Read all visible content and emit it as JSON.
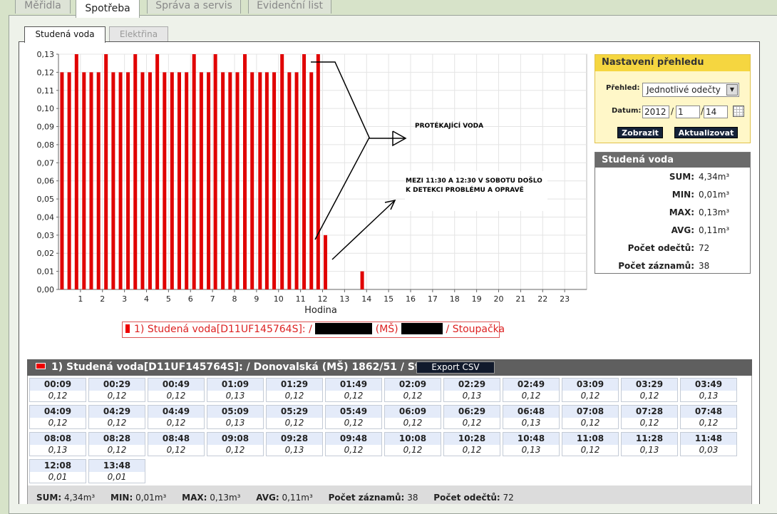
{
  "tabs": [
    "Měřidla",
    "Spotřeba",
    "Správa a servis",
    "Evidenční list"
  ],
  "active_tab": "Spotřeba",
  "sub_tabs": [
    "Studená voda",
    "Elektřina"
  ],
  "active_sub_tab": "Studená voda",
  "chart_data": {
    "type": "bar",
    "xlabel": "Hodina",
    "ylabel": "",
    "ylim": [
      0,
      0.13
    ],
    "xlim": [
      0,
      24
    ],
    "x_ticks": [
      "1",
      "2",
      "3",
      "4",
      "5",
      "6",
      "7",
      "8",
      "9",
      "10",
      "11",
      "12",
      "13",
      "14",
      "15",
      "16",
      "17",
      "18",
      "19",
      "20",
      "21",
      "22",
      "23"
    ],
    "y_ticks": [
      "0,00",
      "0,01",
      "0,02",
      "0,03",
      "0,04",
      "0,05",
      "0,06",
      "0,07",
      "0,08",
      "0,09",
      "0,10",
      "0,11",
      "0,12",
      "0,13"
    ],
    "series": [
      {
        "name": "1) Studená voda[D11UF145764S]:",
        "color": "#e00000",
        "x": [
          0.16,
          0.49,
          0.82,
          1.16,
          1.49,
          1.82,
          2.16,
          2.49,
          2.82,
          3.16,
          3.49,
          3.82,
          4.16,
          4.49,
          4.82,
          5.16,
          5.49,
          5.82,
          6.16,
          6.49,
          6.82,
          7.13,
          7.47,
          7.8,
          8.13,
          8.47,
          8.8,
          9.16,
          9.47,
          9.8,
          10.16,
          10.49,
          10.82,
          11.16,
          11.49,
          11.8,
          12.13,
          13.8
        ],
        "values": [
          0.12,
          0.12,
          0.13,
          0.12,
          0.12,
          0.12,
          0.13,
          0.12,
          0.12,
          0.12,
          0.13,
          0.12,
          0.12,
          0.13,
          0.12,
          0.12,
          0.12,
          0.12,
          0.13,
          0.12,
          0.12,
          0.13,
          0.12,
          0.12,
          0.12,
          0.13,
          0.12,
          0.12,
          0.12,
          0.12,
          0.13,
          0.12,
          0.12,
          0.13,
          0.12,
          0.13,
          0.03,
          0.01
        ]
      }
    ],
    "annotations": [
      "PROTÉKAJÍCÍ VODA",
      "MEZI 11:30 A 12:30 V SOBOTU DOŠLO",
      "K DETEKCI PROBLÉMU A OPRAVĚ"
    ]
  },
  "legend": {
    "prefix": "1) Studená voda[D11UF145764S]:  /",
    "middle": "(MŠ)",
    "suffix": "/ Stoupačka"
  },
  "settings": {
    "title": "Nastavení přehledu",
    "prehled_label": "Přehled:",
    "prehled_value": "Jednotlivé odečty",
    "datum_label": "Datum:",
    "year": "2012",
    "month": "1",
    "day": "14",
    "show_button": "Zobrazit",
    "refresh_button": "Aktualizovat"
  },
  "stats": {
    "title": "Studená voda",
    "rows": [
      {
        "label": "SUM:",
        "value": "4,34m³"
      },
      {
        "label": "MIN:",
        "value": "0,01m³"
      },
      {
        "label": "MAX:",
        "value": "0,13m³"
      },
      {
        "label": "AVG:",
        "value": "0,11m³"
      },
      {
        "label": "Počet odečtů:",
        "value": "72"
      },
      {
        "label": "Počet záznamů:",
        "value": "38"
      }
    ]
  },
  "table": {
    "title": "1) Studená voda[D11UF145764S]: / Donovalská (MŠ) 1862/51 / Stoupačka",
    "export_label": "Export CSV",
    "readings": [
      {
        "time": "00:09",
        "value": "0,12"
      },
      {
        "time": "00:29",
        "value": "0,12"
      },
      {
        "time": "00:49",
        "value": "0,12"
      },
      {
        "time": "01:09",
        "value": "0,13"
      },
      {
        "time": "01:29",
        "value": "0,12"
      },
      {
        "time": "01:49",
        "value": "0,12"
      },
      {
        "time": "02:09",
        "value": "0,12"
      },
      {
        "time": "02:29",
        "value": "0,13"
      },
      {
        "time": "02:49",
        "value": "0,12"
      },
      {
        "time": "03:09",
        "value": "0,12"
      },
      {
        "time": "03:29",
        "value": "0,12"
      },
      {
        "time": "03:49",
        "value": "0,13"
      },
      {
        "time": "04:09",
        "value": "0,12"
      },
      {
        "time": "04:29",
        "value": "0,12"
      },
      {
        "time": "04:49",
        "value": "0,12"
      },
      {
        "time": "05:09",
        "value": "0,13"
      },
      {
        "time": "05:29",
        "value": "0,12"
      },
      {
        "time": "05:49",
        "value": "0,12"
      },
      {
        "time": "06:09",
        "value": "0,12"
      },
      {
        "time": "06:29",
        "value": "0,12"
      },
      {
        "time": "06:48",
        "value": "0,13"
      },
      {
        "time": "07:08",
        "value": "0,12"
      },
      {
        "time": "07:28",
        "value": "0,12"
      },
      {
        "time": "07:48",
        "value": "0,12"
      },
      {
        "time": "08:08",
        "value": "0,13"
      },
      {
        "time": "08:28",
        "value": "0,12"
      },
      {
        "time": "08:48",
        "value": "0,12"
      },
      {
        "time": "09:08",
        "value": "0,12"
      },
      {
        "time": "09:28",
        "value": "0,13"
      },
      {
        "time": "09:48",
        "value": "0,12"
      },
      {
        "time": "10:08",
        "value": "0,12"
      },
      {
        "time": "10:28",
        "value": "0,12"
      },
      {
        "time": "10:48",
        "value": "0,13"
      },
      {
        "time": "11:08",
        "value": "0,12"
      },
      {
        "time": "11:28",
        "value": "0,13"
      },
      {
        "time": "11:48",
        "value": "0,03"
      },
      {
        "time": "12:08",
        "value": "0,01"
      },
      {
        "time": "13:48",
        "value": "0,01"
      }
    ]
  },
  "summary": {
    "sum_label": "SUM:",
    "sum_value": "4,34m³",
    "min_label": "MIN:",
    "min_value": "0,01m³",
    "max_label": "MAX:",
    "max_value": "0,13m³",
    "avg_label": "AVG:",
    "avg_value": "0,11m³",
    "zaznamu_label": "Počet záznamů:",
    "zaznamu_value": "38",
    "odectu_label": "Počet odečtů:",
    "odectu_value": "72"
  }
}
